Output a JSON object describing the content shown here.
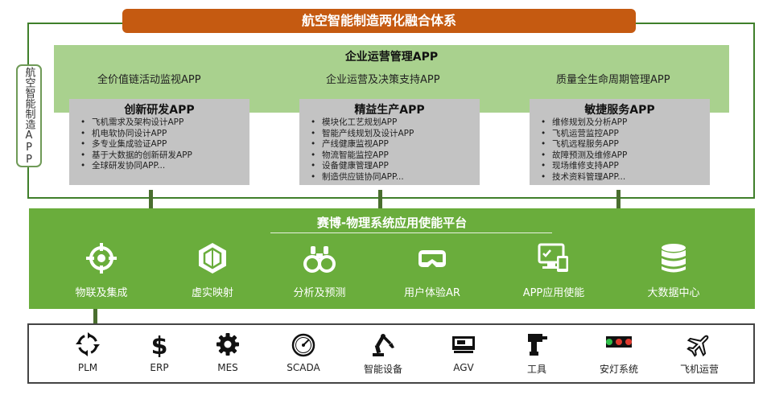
{
  "title": "航空智能制造两化融合体系",
  "side_label": "航空智能制造APP",
  "enterprise": {
    "title": "企业运营管理APP",
    "items": [
      "全价值链活动监视APP",
      "企业运营及决策支持APP",
      "质量全生命周期管理APP"
    ]
  },
  "app_groups": [
    {
      "title": "创新研发APP",
      "items": [
        "飞机需求及架构设计APP",
        "机电软协同设计APP",
        "多专业集成验证APP",
        "基于大数据的创新研发APP",
        "全球研发协同APP..."
      ]
    },
    {
      "title": "精益生产APP",
      "items": [
        "模块化工艺规划APP",
        "智能产线规划及设计APP",
        "产线健康监视APP",
        "物流智能监控APP",
        "设备健康管理APP",
        "制造供应链协同APP..."
      ]
    },
    {
      "title": "敏捷服务APP",
      "items": [
        "维修规划及分析APP",
        "飞机运营监控APP",
        "飞机远程服务APP",
        "故障预测及维修APP",
        "现场维修支持APP",
        "技术资料管理APP..."
      ]
    }
  ],
  "platform": {
    "title": "赛博-物理系统应用使能平台",
    "items": [
      {
        "label": "物联及集成",
        "icon": "crosshair-icon"
      },
      {
        "label": "虚实映射",
        "icon": "hexagon-icon"
      },
      {
        "label": "分析及预测",
        "icon": "binoculars-icon"
      },
      {
        "label": "用户体验AR",
        "icon": "vr-headset-icon"
      },
      {
        "label": "APP应用使能",
        "icon": "devices-icon"
      },
      {
        "label": "大数据中心",
        "icon": "database-icon"
      }
    ]
  },
  "devices": [
    {
      "label": "PLM",
      "icon": "cycle-arrows-icon"
    },
    {
      "label": "ERP",
      "icon": "dollar-icon"
    },
    {
      "label": "MES",
      "icon": "gear-icon"
    },
    {
      "label": "SCADA",
      "icon": "gauge-icon"
    },
    {
      "label": "智能设备",
      "icon": "robot-arm-icon"
    },
    {
      "label": "AGV",
      "icon": "agv-icon"
    },
    {
      "label": "工具",
      "icon": "drill-icon"
    },
    {
      "label": "安灯系统",
      "icon": "andon-light-icon"
    },
    {
      "label": "飞机运营",
      "icon": "airplane-icon"
    }
  ],
  "colors": {
    "banner": "#c55a11",
    "ops_band": "#a9d18e",
    "platform": "#6aad3c",
    "frame": "#3f7f2a",
    "panel": "#c3c3c3"
  }
}
